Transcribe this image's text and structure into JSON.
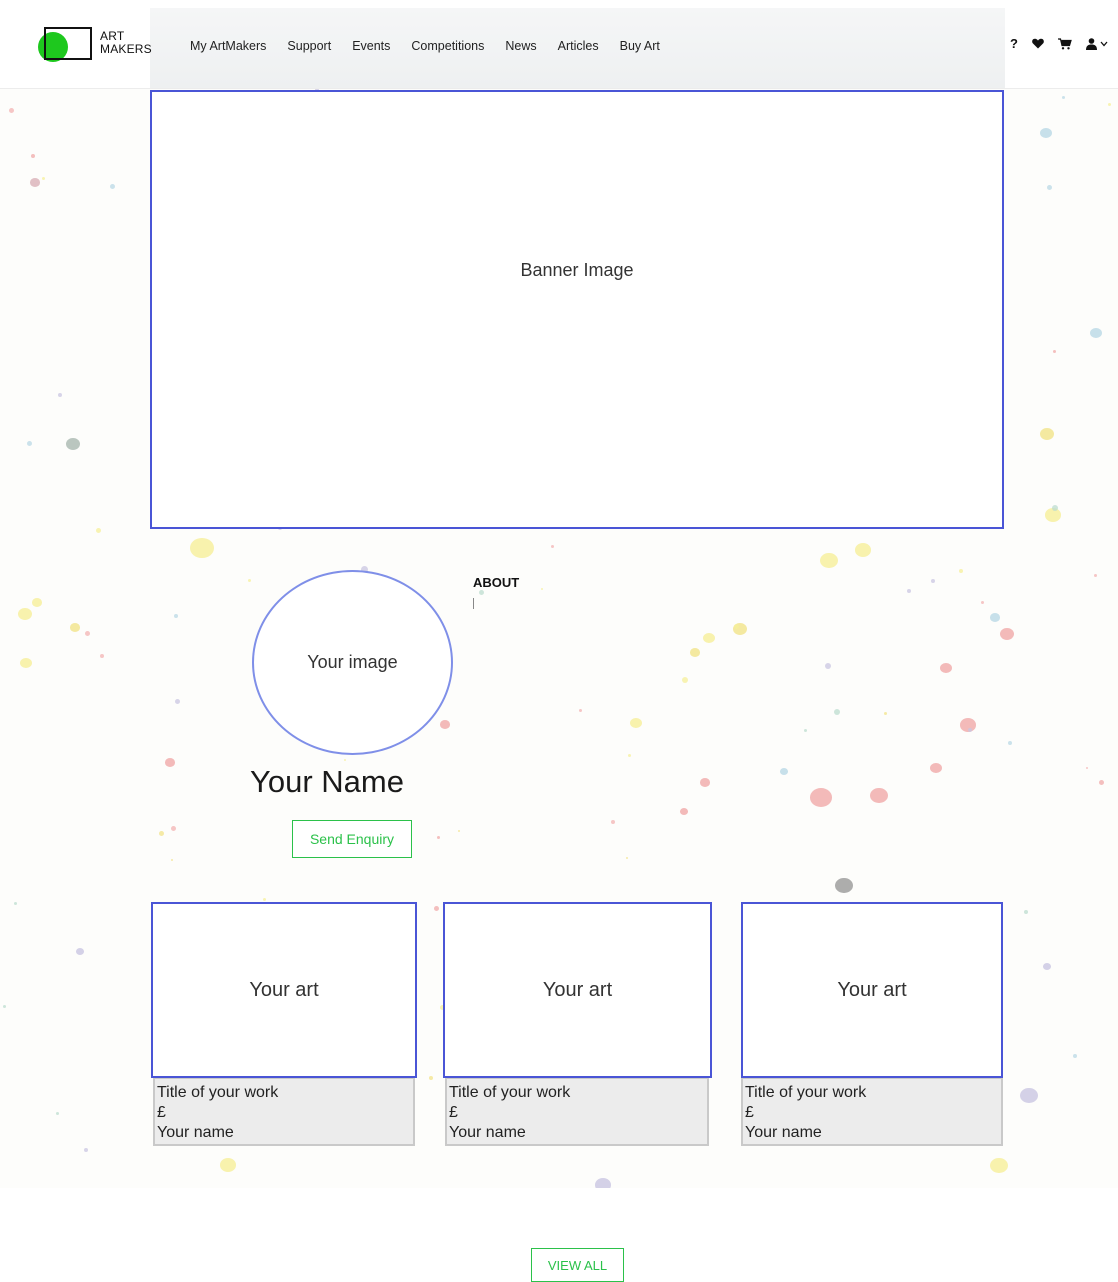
{
  "header": {
    "logo": {
      "line1": "ART",
      "line2": "MAKERS",
      "color": "#1ec81e"
    },
    "nav": [
      {
        "label": "My ArtMakers"
      },
      {
        "label": "Support"
      },
      {
        "label": "Events"
      },
      {
        "label": "Competitions"
      },
      {
        "label": "News"
      },
      {
        "label": "Articles"
      },
      {
        "label": "Buy Art"
      }
    ],
    "icons": {
      "help": "?",
      "help_icon": "question-icon",
      "wishlist_icon": "heart-icon",
      "cart_icon": "cart-icon",
      "account_icon": "user-icon",
      "account_menu_icon": "chevron-down-icon"
    }
  },
  "banner": {
    "label": "Banner Image",
    "border_color": "#4a55d6"
  },
  "profile": {
    "image_label": "Your image",
    "name": "Your Name",
    "send_enquiry_label": "Send Enquiry",
    "about_heading": "ABOUT",
    "accent_color": "#2bc14a"
  },
  "artworks": [
    {
      "frame_label": "Your art",
      "title": "Title of your work",
      "price": "£",
      "artist": "Your name"
    },
    {
      "frame_label": "Your art",
      "title": "Title of your work",
      "price": "£",
      "artist": "Your name"
    },
    {
      "frame_label": "Your art",
      "title": "Title of your work",
      "price": "£",
      "artist": "Your name"
    }
  ],
  "view_all_label": "VIEW ALL"
}
